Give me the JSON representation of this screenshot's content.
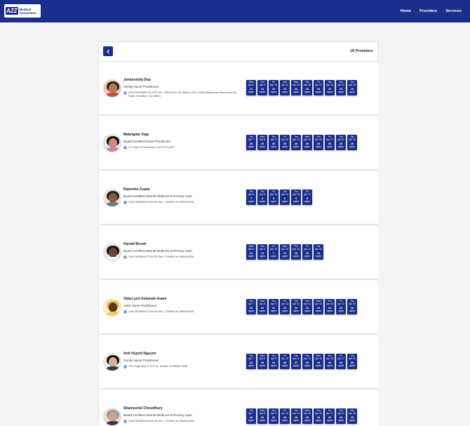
{
  "header": {
    "logo_mark": "AZZ",
    "logo_text_1": "Medical",
    "logo_text_2": "Associates",
    "nav": [
      "Home",
      "Providers",
      "Services"
    ]
  },
  "panel": {
    "count_label": "18 Providers"
  },
  "providers": [
    {
      "name": "Johannelda Diaz",
      "title": "Family Nurse Practitioner",
      "address": "2370 HIGHWAY 33 STE 103, TRENTON, NJ 08690-1790 / 3333 Whitehorse Mercerville Rd, Suite J Hamilton, NJ 08619",
      "avatar": {
        "skin": "#b07a5a",
        "hair": "#3a2418",
        "shirt": "#c94a4a",
        "bg": "#e9c9b2"
      },
      "slots": [
        {
          "d": "Wed",
          "m": "Apr 8",
          "n": "12",
          "u": "appts"
        },
        {
          "d": "Thu",
          "m": "Apr 9",
          "n": "14",
          "u": "appts"
        },
        {
          "d": "Fri",
          "m": "Apr 10",
          "n": "16",
          "u": "appts"
        },
        {
          "d": "Sat",
          "m": "Apr 11",
          "n": "16",
          "u": "appts"
        },
        {
          "d": "Wed",
          "m": "Apr 15",
          "n": "16",
          "u": "appts"
        },
        {
          "d": "Thu",
          "m": "Apr 16",
          "n": "16",
          "u": "appts"
        },
        {
          "d": "Fri",
          "m": "Apr 17",
          "n": "16",
          "u": "appts"
        },
        {
          "d": "Sat",
          "m": "Apr 18",
          "n": "16",
          "u": "appts"
        },
        {
          "d": "Tue",
          "m": "Apr 21",
          "n": "16",
          "u": "appts"
        },
        {
          "d": "Tue",
          "m": "Apr 28",
          "n": "16",
          "u": "appts"
        }
      ]
    },
    {
      "name": "Mabrigida Viaje",
      "title": "Board Certified Nurse Practitioner",
      "address": "177 Main St Metuchen, NJ 07747-6127",
      "avatar": {
        "skin": "#c99270",
        "hair": "#1a1310",
        "shirt": "#e07aa0",
        "bg": "#dfe6f4"
      },
      "slots": [
        {
          "d": "Tue",
          "m": "Apr 7",
          "n": "18",
          "u": "appts"
        },
        {
          "d": "Wed",
          "m": "Apr 8",
          "n": "20",
          "u": "appts"
        },
        {
          "d": "Thu",
          "m": "Apr 9",
          "n": "20",
          "u": "appts"
        },
        {
          "d": "Fri",
          "m": "Apr 10",
          "n": "20",
          "u": "appts"
        },
        {
          "d": "Tue",
          "m": "Apr 14",
          "n": "20",
          "u": "appts"
        },
        {
          "d": "Wed",
          "m": "Apr 15",
          "n": "20",
          "u": "appts"
        },
        {
          "d": "Thu",
          "m": "Apr 16",
          "n": "20",
          "u": "appts"
        },
        {
          "d": "Fri",
          "m": "Apr 17",
          "n": "20",
          "u": "appts"
        },
        {
          "d": "Tue",
          "m": "Apr 21",
          "n": "20",
          "u": "appts"
        },
        {
          "d": "Sat",
          "m": "Apr 18",
          "n": "20",
          "u": "appts"
        }
      ]
    },
    {
      "name": "Rajendra Gupta",
      "title": "Board Certified Internal Medicine & Primary Care",
      "address": "1440 DENNINGTON RD Ste 1, EWING NJ 08618-0000",
      "avatar": {
        "skin": "#8a5a3c",
        "hair": "#2a2420",
        "shirt": "#6a7a8a",
        "bg": "#e8e8e8"
      },
      "slots": [
        {
          "d": "Tue",
          "m": "Apr 8",
          "n": "7",
          "u": "appts"
        },
        {
          "d": "Thu",
          "m": "Apr 9",
          "n": "5",
          "u": "appts"
        },
        {
          "d": "Fri",
          "m": "Apr 10",
          "n": "5",
          "u": "appts"
        },
        {
          "d": "Tue",
          "m": "Apr 14",
          "n": "6",
          "u": "appts"
        },
        {
          "d": "Thu",
          "m": "Apr 16",
          "n": "5",
          "u": "appts"
        },
        {
          "d": "Fri",
          "m": "Apr 17",
          "n": "5",
          "u": "appts"
        }
      ]
    },
    {
      "name": "Harold Brown",
      "title": "Board Certified Internal Medicine & Primary Care",
      "address": "1440 DENNINGTON RD Ste 1, EWING NJ 08618-0000",
      "avatar": {
        "skin": "#6e4630",
        "hair": "#1e1612",
        "shirt": "#f2f2f2",
        "bg": "#e6e6e6"
      },
      "slots": [
        {
          "d": "Wed",
          "m": "Apr 8",
          "n": "14",
          "u": "appts"
        },
        {
          "d": "Thu",
          "m": "Apr 9",
          "n": "12",
          "u": "appts"
        },
        {
          "d": "Fri",
          "m": "Apr 10",
          "n": "7",
          "u": "appts"
        },
        {
          "d": "Wed",
          "m": "Apr 15",
          "n": "12",
          "u": "appts"
        },
        {
          "d": "Thu",
          "m": "Apr 16",
          "n": "15",
          "u": "appts"
        },
        {
          "d": "Fri",
          "m": "Apr 17",
          "n": "10",
          "u": "appts"
        },
        {
          "d": "Sat",
          "m": "Apr 18",
          "n": "14",
          "u": "appts"
        }
      ]
    },
    {
      "name": "Vida-Lynn Aslamah-Asare",
      "title": "Adult Nurse Practitioner",
      "address": "1440 DENNINGTON RD Ste 1, EWING NJ 08618-0000",
      "avatar": {
        "skin": "#5a3624",
        "hair": "#e9c23a",
        "shirt": "#f0d34a",
        "bg": "#fbf3d0"
      },
      "slots": [
        {
          "d": "Tue",
          "m": "Apr 7",
          "n": "20",
          "u": "appts"
        },
        {
          "d": "Wed",
          "m": "Apr 8",
          "n": "22",
          "u": "appts"
        },
        {
          "d": "Thu",
          "m": "Apr 9",
          "n": "21",
          "u": "appts"
        },
        {
          "d": "Fri",
          "m": "Apr 10",
          "n": "22",
          "u": "appts"
        },
        {
          "d": "Sat",
          "m": "Apr 11",
          "n": "22",
          "u": "appts"
        },
        {
          "d": "Tue",
          "m": "Apr 14",
          "n": "22",
          "u": "appts"
        },
        {
          "d": "Wed",
          "m": "Apr 15",
          "n": "22",
          "u": "appts"
        },
        {
          "d": "Thu",
          "m": "Apr 16",
          "n": "22",
          "u": "appts"
        },
        {
          "d": "Fri",
          "m": "Apr 17",
          "n": "22",
          "u": "appts"
        },
        {
          "d": "Tue",
          "m": "Apr 21",
          "n": "22",
          "u": "appts"
        }
      ]
    },
    {
      "name": "Anh Huynh-Nguyen",
      "title": "Family Nurse Practitioner",
      "address": "700 Kings Way E STE 01, Sewell, NJ 08080-5338",
      "avatar": {
        "skin": "#d9b096",
        "hair": "#1b1410",
        "shirt": "#3b3b3b",
        "bg": "#ececec"
      },
      "slots": [
        {
          "d": "Tue",
          "m": "Apr 7",
          "n": "23",
          "u": "appts"
        },
        {
          "d": "Wed",
          "m": "Apr 8",
          "n": "25",
          "u": "appts"
        },
        {
          "d": "Thu",
          "m": "Apr 9",
          "n": "25",
          "u": "appts"
        },
        {
          "d": "Fri",
          "m": "Apr 10",
          "n": "26",
          "u": "appts"
        },
        {
          "d": "Sat",
          "m": "Apr 11",
          "n": "27",
          "u": "appts"
        },
        {
          "d": "Tue",
          "m": "Apr 14",
          "n": "29",
          "u": "appts"
        },
        {
          "d": "Wed",
          "m": "Apr 15",
          "n": "29",
          "u": "appts"
        },
        {
          "d": "Thu",
          "m": "Apr 16",
          "n": "29",
          "u": "appts"
        },
        {
          "d": "Fri",
          "m": "Apr 17",
          "n": "29",
          "u": "appts"
        },
        {
          "d": "Tue",
          "m": "Apr 21",
          "n": "29",
          "u": "appts"
        }
      ]
    },
    {
      "name": "Shamsurlal Chowdhury",
      "title": "Board Certified Internal Medicine & Primary Care",
      "address": "1440 DENNINGTON RD Ste 1, EWING NJ 08618-0000",
      "avatar": {
        "skin": "#c9a48a",
        "hair": "#9a9a9a",
        "shirt": "#2f3b56",
        "bg": "#e2e2e2"
      },
      "slots": [
        {
          "d": "Tue",
          "m": "Apr 7",
          "n": "16",
          "u": "appts"
        },
        {
          "d": "Wed",
          "m": "Apr 8",
          "n": "16",
          "u": "appts"
        },
        {
          "d": "Thu",
          "m": "Apr 9",
          "n": "16",
          "u": "appts"
        },
        {
          "d": "Fri",
          "m": "Apr 10",
          "n": "16",
          "u": "appts"
        },
        {
          "d": "Tue",
          "m": "Apr 14",
          "n": "16",
          "u": "appts"
        },
        {
          "d": "Wed",
          "m": "Apr 15",
          "n": "16",
          "u": "appts"
        },
        {
          "d": "Thu",
          "m": "Apr 16",
          "n": "16",
          "u": "appts"
        },
        {
          "d": "Fri",
          "m": "Apr 17",
          "n": "16",
          "u": "appts"
        },
        {
          "d": "Tue",
          "m": "Apr 21",
          "n": "16",
          "u": "appts"
        },
        {
          "d": "Sat",
          "m": "Apr 18",
          "n": "16",
          "u": "appts"
        }
      ]
    }
  ]
}
